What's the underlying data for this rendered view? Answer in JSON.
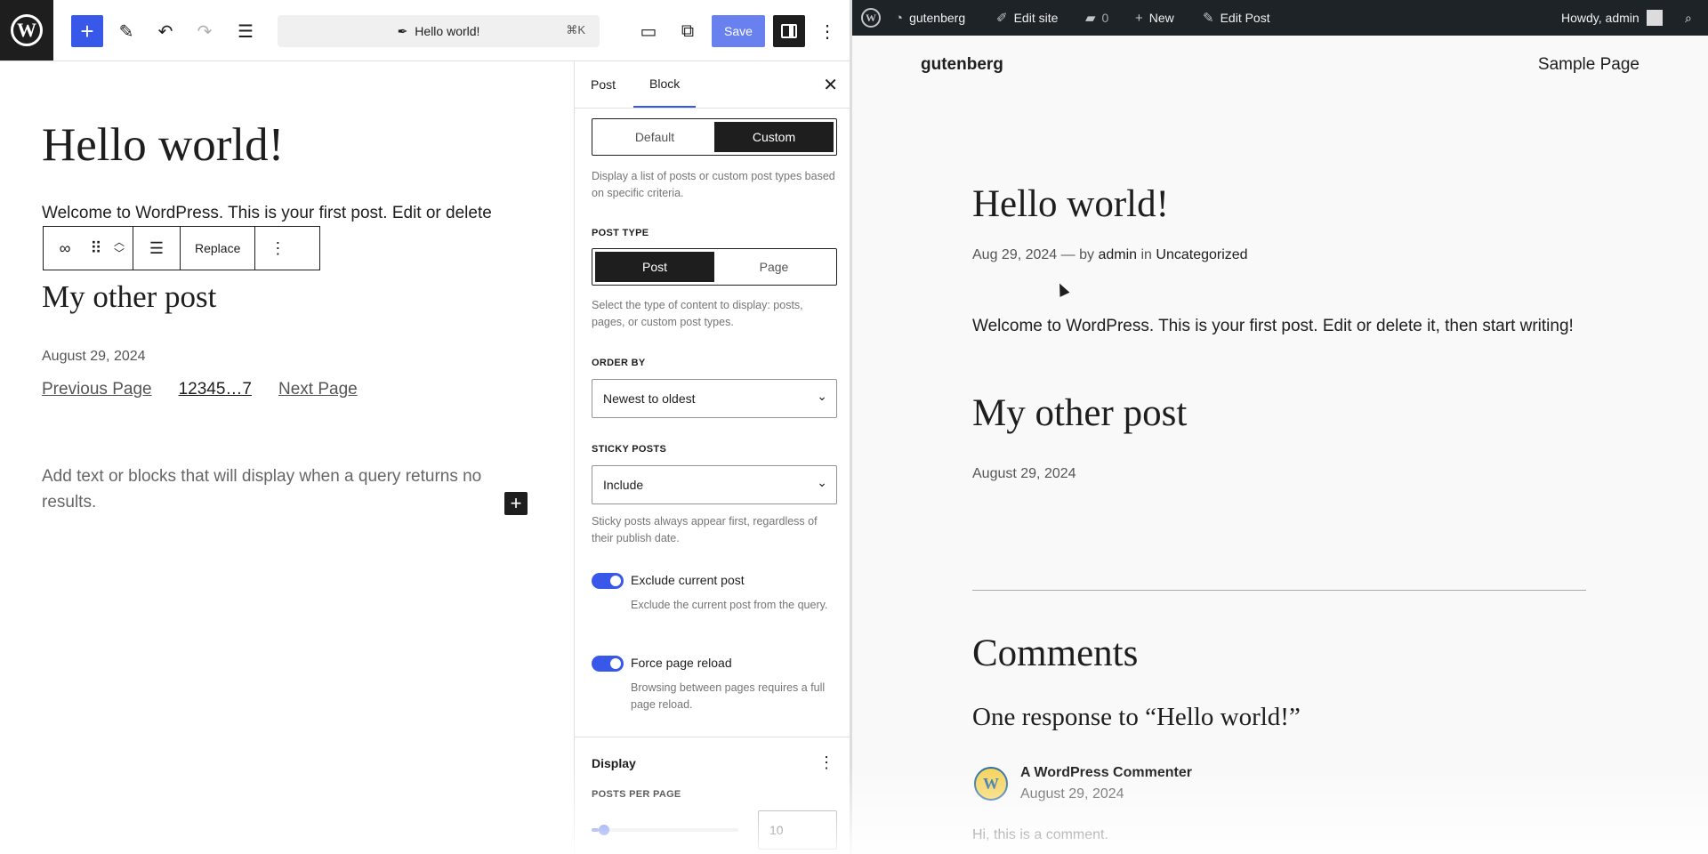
{
  "editor": {
    "toolbar": {
      "document_title": "Hello world!",
      "shortcut": "⌘K",
      "save_label": "Save"
    },
    "canvas": {
      "title": "Hello world!",
      "excerpt": "Welcome to WordPress. This is your first post. Edit or delete",
      "block_toolbar_replace": "Replace",
      "post2_title": "My other post",
      "post2_date": "August 29, 2024",
      "pagination_prev": "Previous Page",
      "pagination_numbers": "12345…7",
      "pagination_next": "Next Page",
      "no_results": "Add text or blocks that will display when a query returns no results."
    },
    "sidebar": {
      "tabs": [
        "Post",
        "Block"
      ],
      "active_tab": "Block",
      "query_mode": {
        "options": [
          "Default",
          "Custom"
        ],
        "selected": "Custom"
      },
      "query_help": "Display a list of posts or custom post types based on specific criteria.",
      "post_type_label": "POST TYPE",
      "post_type": {
        "options": [
          "Post",
          "Page"
        ],
        "selected": "Post"
      },
      "post_type_help": "Select the type of content to display: posts, pages, or custom post types.",
      "order_by_label": "ORDER BY",
      "order_by_value": "Newest to oldest",
      "sticky_label": "STICKY POSTS",
      "sticky_value": "Include",
      "sticky_help": "Sticky posts always appear first, regardless of their publish date.",
      "exclude_label": "Exclude current post",
      "exclude_help": "Exclude the current post from the query.",
      "reload_label": "Force page reload",
      "reload_help": "Browsing between pages requires a full page reload.",
      "display_title": "Display",
      "posts_per_page_label": "POSTS PER PAGE",
      "posts_per_page_value": "10",
      "posts_per_page_fraction": 0.05
    }
  },
  "frontend": {
    "adminbar": {
      "site": "gutenberg",
      "edit_site": "Edit site",
      "comments_count": "0",
      "new": "New",
      "edit_post": "Edit Post",
      "howdy": "Howdy, admin"
    },
    "site_title": "gutenberg",
    "nav_link": "Sample Page",
    "post_title": "Hello world!",
    "meta_date": "Aug 29, 2024",
    "meta_by": "— by",
    "meta_author": "admin",
    "meta_in": "in",
    "meta_category": "Uncategorized",
    "content": "Welcome to WordPress. This is your first post. Edit or delete it, then start writing!",
    "post2_title": "My other post",
    "post2_date": "August 29, 2024",
    "comments_heading": "Comments",
    "response_heading": "One response to “Hello world!”",
    "commenter": "A WordPress Commenter",
    "comment_date": "August 29, 2024",
    "comment_text": "Hi, this is a comment."
  }
}
